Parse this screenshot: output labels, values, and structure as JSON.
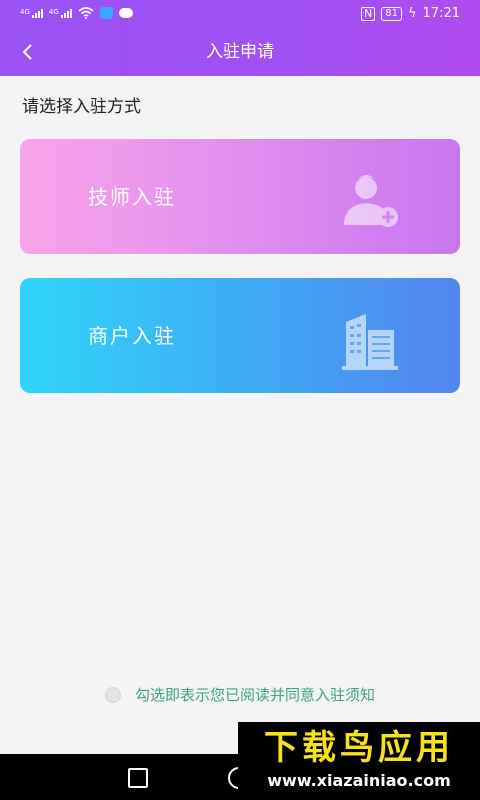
{
  "status_bar": {
    "net1": "4G",
    "net2": "4G",
    "nfc": "N",
    "battery": "81",
    "time": "17:21"
  },
  "header": {
    "title": "入驻申请"
  },
  "main": {
    "prompt": "请选择入驻方式",
    "options": [
      {
        "label": "技师入驻",
        "icon": "person-add-icon"
      },
      {
        "label": "商户入驻",
        "icon": "building-icon"
      }
    ]
  },
  "agreement": {
    "text": "勾选即表示您已阅读并同意入驻须知"
  },
  "watermark": {
    "title": "下载鸟应用",
    "url": "www.xiazainiao.com"
  },
  "colors": {
    "header": "#9a52f5",
    "tech_card": "#e28ef0",
    "merchant_card": "#3fa8f5",
    "agreement_text": "#3fa37a"
  }
}
